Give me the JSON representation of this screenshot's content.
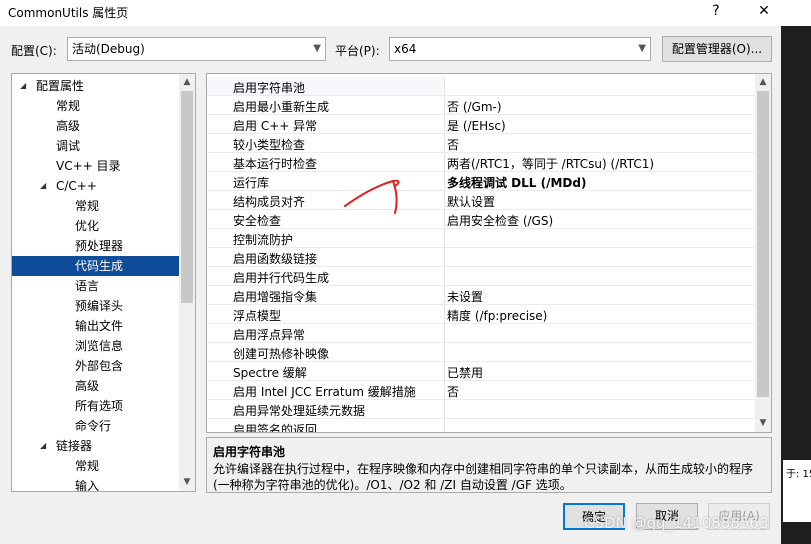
{
  "window": {
    "title": "CommonUtils 属性页",
    "help": "?",
    "close": "✕"
  },
  "config": {
    "label": "配置(C):",
    "value": "活动(Debug)"
  },
  "platform": {
    "label": "平台(P):",
    "value": "x64"
  },
  "config_manager": "配置管理器(O)...",
  "tree": [
    {
      "label": "配置属性",
      "level": 0,
      "expanded": true
    },
    {
      "label": "常规",
      "level": 1
    },
    {
      "label": "高级",
      "level": 1
    },
    {
      "label": "调试",
      "level": 1
    },
    {
      "label": "VC++ 目录",
      "level": 1
    },
    {
      "label": "C/C++",
      "level": 1,
      "expanded": true
    },
    {
      "label": "常规",
      "level": 2
    },
    {
      "label": "优化",
      "level": 2
    },
    {
      "label": "预处理器",
      "level": 2
    },
    {
      "label": "代码生成",
      "level": 2,
      "selected": true
    },
    {
      "label": "语言",
      "level": 2
    },
    {
      "label": "预编译头",
      "level": 2
    },
    {
      "label": "输出文件",
      "level": 2
    },
    {
      "label": "浏览信息",
      "level": 2
    },
    {
      "label": "外部包含",
      "level": 2
    },
    {
      "label": "高级",
      "level": 2
    },
    {
      "label": "所有选项",
      "level": 2
    },
    {
      "label": "命令行",
      "level": 2
    },
    {
      "label": "链接器",
      "level": 1,
      "expanded": true
    },
    {
      "label": "常规",
      "level": 2
    },
    {
      "label": "输入",
      "level": 2
    }
  ],
  "properties": [
    {
      "name": "启用字符串池",
      "value": ""
    },
    {
      "name": "启用最小重新生成",
      "value": "否 (/Gm-)"
    },
    {
      "name": "启用 C++ 异常",
      "value": "是 (/EHsc)"
    },
    {
      "name": "较小类型检查",
      "value": "否"
    },
    {
      "name": "基本运行时检查",
      "value": "两者(/RTC1，等同于 /RTCsu) (/RTC1)"
    },
    {
      "name": "运行库",
      "value": "多线程调试 DLL (/MDd)",
      "bold": true
    },
    {
      "name": "结构成员对齐",
      "value": "默认设置"
    },
    {
      "name": "安全检查",
      "value": "启用安全检查 (/GS)"
    },
    {
      "name": "控制流防护",
      "value": ""
    },
    {
      "name": "启用函数级链接",
      "value": ""
    },
    {
      "name": "启用并行代码生成",
      "value": ""
    },
    {
      "name": "启用增强指令集",
      "value": "未设置"
    },
    {
      "name": "浮点模型",
      "value": "精度 (/fp:precise)"
    },
    {
      "name": "启用浮点异常",
      "value": ""
    },
    {
      "name": "创建可热修补映像",
      "value": ""
    },
    {
      "name": "Spectre 缓解",
      "value": "已禁用"
    },
    {
      "name": "启用 Intel JCC Erratum 缓解措施",
      "value": "否"
    },
    {
      "name": "启用异常处理延续元数据",
      "value": ""
    },
    {
      "name": "启用签名的返回",
      "value": ""
    }
  ],
  "description": {
    "title": "启用字符串池",
    "text": "允许编译器在执行过程中，在程序映像和内存中创建相同字符串的单个只读副本，从而生成较小的程序(一种称为字符串池的优化)。/O1、/O2 和 /ZI 自动设置 /GF 选项。"
  },
  "buttons": {
    "ok": "确定",
    "cancel": "取消",
    "apply": "应用(A)"
  },
  "watermark": "CSDN @qq_1410888563",
  "side_fragment": "于: 15"
}
